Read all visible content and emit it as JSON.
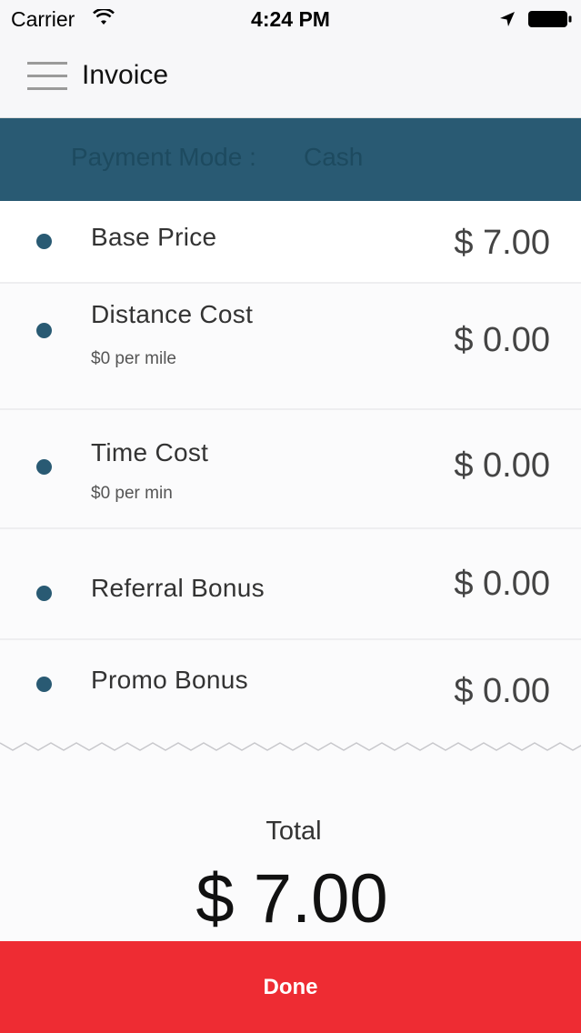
{
  "status_bar": {
    "carrier": "Carrier",
    "time": "4:24 PM"
  },
  "nav": {
    "title": "Invoice"
  },
  "payment": {
    "label": "Payment Mode :",
    "value": "Cash"
  },
  "items": [
    {
      "label": "Base Price",
      "sub": "",
      "amount": "$ 7.00"
    },
    {
      "label": "Distance Cost",
      "sub": "$0 per mile",
      "amount": "$ 0.00"
    },
    {
      "label": "Time Cost",
      "sub": "$0 per min",
      "amount": "$ 0.00"
    },
    {
      "label": "Referral Bonus",
      "sub": "",
      "amount": "$ 0.00"
    },
    {
      "label": "Promo Bonus",
      "sub": "",
      "amount": "$ 0.00"
    }
  ],
  "total": {
    "label": "Total",
    "amount": "$ 7.00"
  },
  "done_button": {
    "label": "Done"
  },
  "colors": {
    "primary": "#295a73",
    "done": "#ee2c33"
  }
}
